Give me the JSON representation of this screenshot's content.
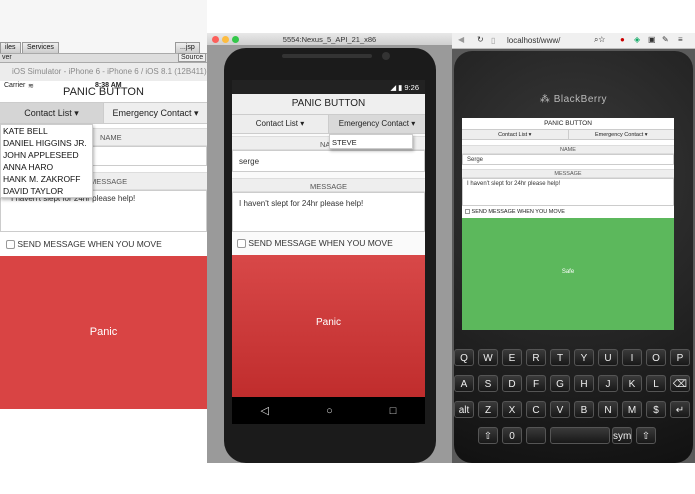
{
  "ios": {
    "tabs": [
      "iles",
      "Services"
    ],
    "source_tab": "Source",
    "jsp_tab": "...jsp",
    "ver": "ver",
    "sim_title": "iOS Simulator - iPhone 6 - iPhone 6 / iOS 8.1 (12B411)",
    "carrier": "Carrier",
    "time": "8:38 AM",
    "app_title": "PANIC BUTTON",
    "contact_list_label": "Contact List ▾",
    "emergency_contact_label": "Emergency Contact ▾",
    "dropdown_items": [
      "KATE BELL",
      "DANIEL HIGGINS JR.",
      "JOHN APPLESEED",
      "ANNA HARO",
      "HANK M. ZAKROFF",
      "DAVID TAYLOR"
    ],
    "name_label": "NAME",
    "message_label": "MESSAGE",
    "message_value": "I haven't slept for 24hr please help!",
    "checkbox_label": "SEND MESSAGE WHEN YOU MOVE",
    "panic_label": "Panic"
  },
  "android": {
    "window_title": "5554:Nexus_5_API_21_x86",
    "time": "9:26",
    "app_title": "PANIC BUTTON",
    "contact_list_label": "Contact List ▾",
    "emergency_contact_label": "Emergency Contact ▾",
    "dropdown_items": [
      "STEVE"
    ],
    "name_label": "NAME",
    "name_value": "serge",
    "message_label": "MESSAGE",
    "message_value": "I haven't slept for 24hr please help!",
    "checkbox_label": "SEND MESSAGE WHEN YOU MOVE",
    "panic_label": "Panic",
    "nav": [
      "◁",
      "○",
      "□"
    ]
  },
  "blackberry": {
    "url": "localhost/www/",
    "brand": "BlackBerry",
    "app_title": "PANIC BUTTON",
    "contact_list_label": "Contact List ▾",
    "emergency_contact_label": "Emergency Contact ▾",
    "name_label": "NAME",
    "name_value": "Serge",
    "message_label": "MESSAGE",
    "message_value": "I haven't slept for 24hr please help!",
    "checkbox_label": "SEND MESSAGE WHEN YOU MOVE",
    "safe_label": "Safe",
    "safe_color": "#5cb85c",
    "keys": [
      [
        "Q",
        "W",
        "E",
        "R",
        "T",
        "Y",
        "U",
        "I",
        "O",
        "P"
      ],
      [
        "A",
        "S",
        "D",
        "F",
        "G",
        "H",
        "J",
        "K",
        "L",
        "⌫"
      ],
      [
        "alt",
        "Z",
        "X",
        "C",
        "V",
        "B",
        "N",
        "M",
        "$",
        "↵"
      ],
      [
        "⇧",
        "0",
        "",
        "",
        "",
        "",
        "sym",
        "⇧"
      ]
    ]
  },
  "colors": {
    "panic_red": "#d94444",
    "safe_green": "#5cb85c"
  }
}
